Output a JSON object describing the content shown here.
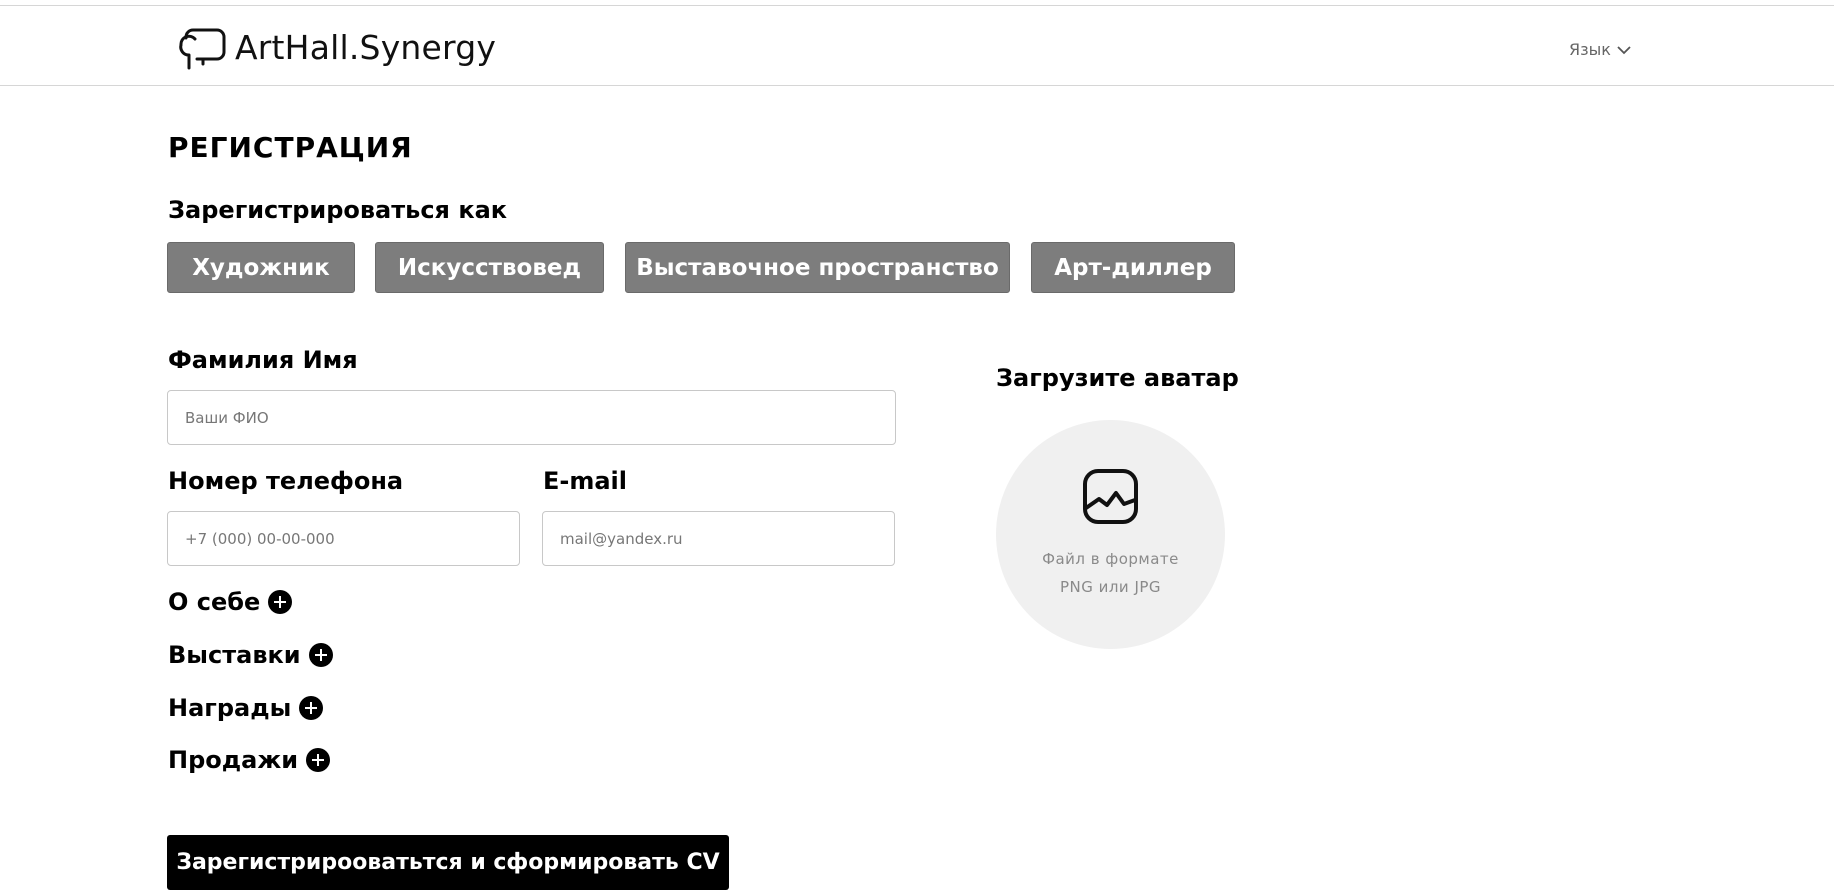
{
  "header": {
    "logo_text": "ArtHall.Synergy",
    "language_label": "Язык"
  },
  "page": {
    "title": "РЕГИСТРАЦИЯ",
    "register_as_label": "Зарегистрироваться как"
  },
  "roles": [
    {
      "label": "Художник"
    },
    {
      "label": "Искусствовед"
    },
    {
      "label": "Выставочное пространство"
    },
    {
      "label": "Арт-диллер"
    }
  ],
  "form": {
    "name": {
      "label": "Фамилия Имя",
      "placeholder": "Ваши ФИО",
      "value": ""
    },
    "phone": {
      "label": "Номер телефона",
      "placeholder": "+7 (000) 00-00-000",
      "value": ""
    },
    "email": {
      "label": "E-mail",
      "placeholder": "mail@yandex.ru",
      "value": ""
    }
  },
  "sections": [
    {
      "label": "О себе",
      "icon": "plus-circle-icon"
    },
    {
      "label": "Выставки",
      "icon": "plus-circle-icon"
    },
    {
      "label": "Награды",
      "icon": "plus-circle-icon"
    },
    {
      "label": "Продажи",
      "icon": "plus-circle-icon"
    }
  ],
  "avatar": {
    "title": "Загрузите аватар",
    "hint_line1": "Файл в формате",
    "hint_line2": "PNG или JPG",
    "icon": "image-icon"
  },
  "submit_label": "Зарегистрирооватьтся и сформировать CV",
  "colors": {
    "role_button_bg": "#7d7d7d",
    "submit_bg": "#000000",
    "avatar_bg": "#f0f0f0"
  }
}
